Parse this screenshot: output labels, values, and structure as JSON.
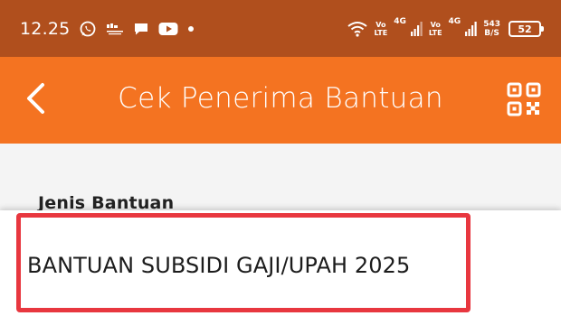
{
  "status_bar": {
    "time": "12.25",
    "notification_icons": [
      "whatsapp-icon",
      "app-icon",
      "chat-icon",
      "youtube-icon",
      "dot-icon"
    ],
    "network_1": "Vo LTE",
    "network_1_line1": "Vo",
    "network_1_line2": "LTE",
    "network_1_type": "4G",
    "network_2_line1": "Vo",
    "network_2_line2": "LTE",
    "network_2_type": "4G",
    "speed_value": "543",
    "speed_unit": "B/S",
    "battery": "52",
    "colors": {
      "background": "#b04f1d"
    }
  },
  "app_bar": {
    "title": "Cek Penerima Bantuan",
    "back_icon": "chevron-left-icon",
    "qr_icon": "qr-code-icon",
    "colors": {
      "background": "#f47321"
    }
  },
  "form": {
    "label": "Jenis Bantuan"
  },
  "dropdown": {
    "options": [
      "BANTUAN SUBSIDI GAJI/UPAH 2025"
    ],
    "highlight_color": "#e8373f"
  }
}
